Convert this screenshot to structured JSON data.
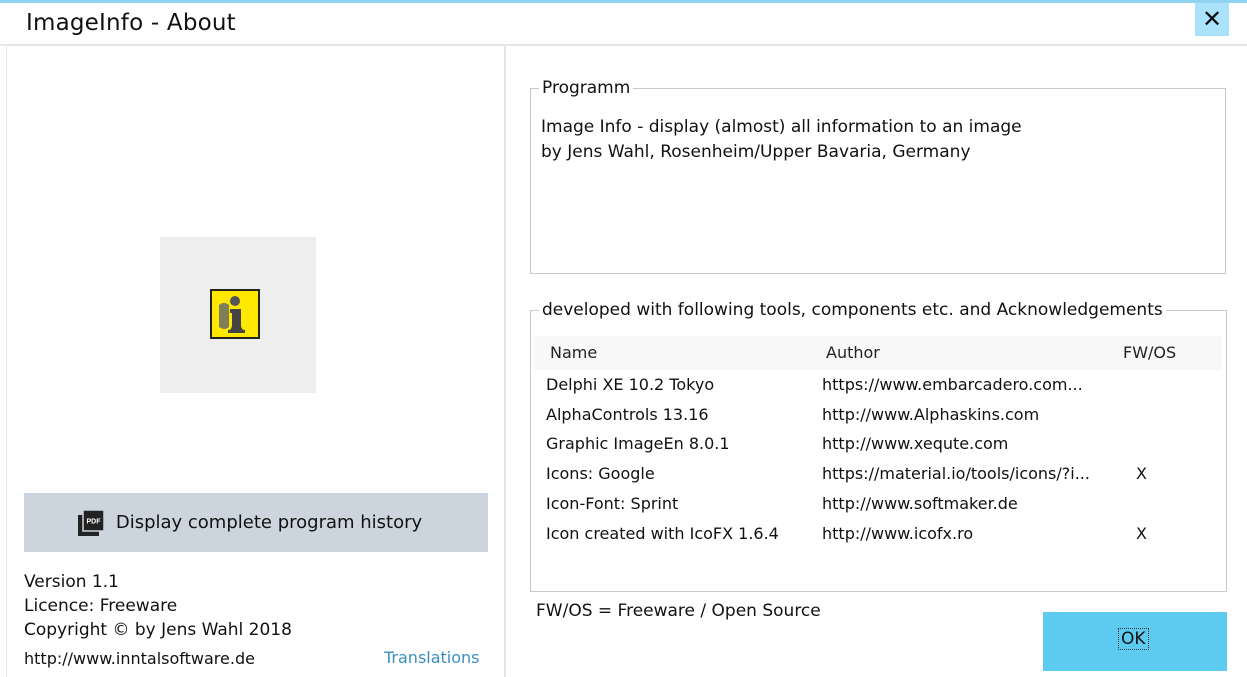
{
  "window": {
    "title": "ImageInfo - About",
    "close_glyph": "✕",
    "accent": "#5ccbef"
  },
  "left": {
    "logo": {
      "icon": "imageinfo-logo-icon",
      "letter": "i",
      "background": "#ffe800"
    },
    "history_button": {
      "label": "Display complete program history",
      "icon": "pdf-icon"
    },
    "version": "Version 1.1",
    "licence": "Licence: Freeware",
    "copyright": "Copyright © by Jens Wahl 2018",
    "website": "http://www.inntalsoftware.de",
    "translations_link": "Translations"
  },
  "program": {
    "legend": "Programm",
    "line1": "Image Info - display (almost) all information to an image",
    "line2": "by Jens Wahl, Rosenheim/Upper Bavaria, Germany"
  },
  "tools": {
    "legend": "developed with following tools, components etc. and Acknowledgements",
    "columns": {
      "name": "Name",
      "author": "Author",
      "fwos": "FW/OS"
    },
    "rows": [
      {
        "name": "Delphi XE 10.2 Tokyo",
        "author": "https://www.embarcadero.com...",
        "fwos": ""
      },
      {
        "name": "AlphaControls 13.16",
        "author": "http://www.Alphaskins.com",
        "fwos": ""
      },
      {
        "name": "Graphic ImageEn 8.0.1",
        "author": "http://www.xequte.com",
        "fwos": ""
      },
      {
        "name": "Icons: Google",
        "author": "https://material.io/tools/icons/?i...",
        "fwos": "X"
      },
      {
        "name": "Icon-Font: Sprint",
        "author": "http://www.softmaker.de",
        "fwos": ""
      },
      {
        "name": "Icon created with IcoFX 1.6.4",
        "author": "http://www.icofx.ro",
        "fwos": "X"
      }
    ],
    "note": "FW/OS = Freeware / Open Source"
  },
  "ok_button": {
    "label": "OK"
  }
}
